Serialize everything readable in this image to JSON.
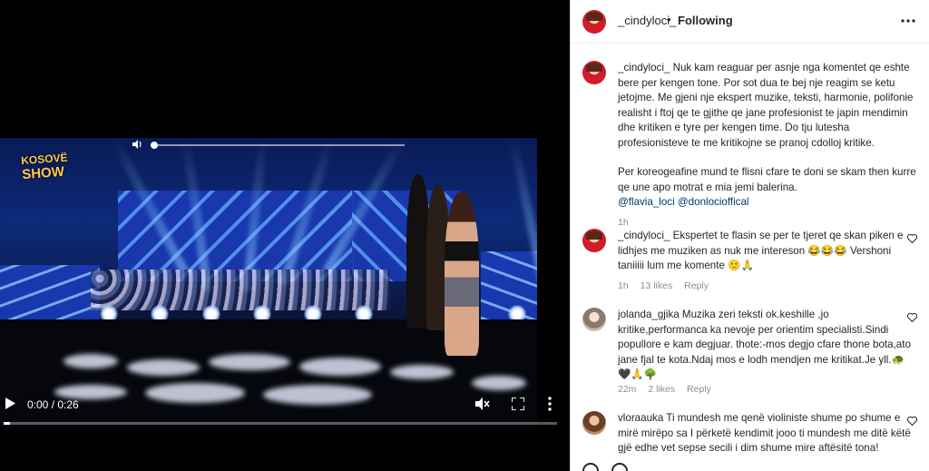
{
  "video": {
    "brand_line1": "KOSOVË",
    "brand_line2": "SHOW",
    "time_display": "0:00 / 0:26",
    "progress": 0.0,
    "volume_icon": "volume-icon",
    "play_icon": "play-icon",
    "mute_icon": "mute-icon",
    "fullscreen_icon": "fullscreen-icon",
    "more_icon": "more-vert-icon"
  },
  "header": {
    "username": "_cindyloci_",
    "separator": "•",
    "follow_status": "Following",
    "more_icon": "more-horiz-icon"
  },
  "caption": {
    "username": "_cindyloci_",
    "text": "Nuk kam reaguar per asnje nga komentet qe eshte bere per kengen tone. Por sot dua te bej nje reagim se ketu jetojme. Me gjeni nje ekspert muzike, teksti, harmonie, polifonie realisht i ftoj qe te gjithe qe jane profesionist te japin mendimin dhe kritiken e tyre per kengen time. Do tju lutesha profesionisteve te me kritikojne se pranoj cdolloj kritike.",
    "text2": "Per koreogeafine mund te flisni cfare te doni se skam then kurre qe une apo motrat e mia jemi balerina.",
    "mentions": "@flavia_loci @donlocioffical",
    "time": "1h"
  },
  "comments": [
    {
      "username": "_cindyloci_",
      "text": "Ekspertet te flasin se per te tjeret qe skan piken e lidhjes me muziken as nuk me intereson 😂😂😂 Vershoni taniiiii lum me komente 🙂🙏",
      "time": "1h",
      "likes": "13 likes",
      "reply": "Reply"
    },
    {
      "username": "jolanda_gjika",
      "text": "Muzika zeri teksti ok.keshille ,jo kritike,performanca ka nevoje per orientim specialisti.Sindi popullore e kam degjuar. thote:-mos degjo cfare thone bota,ato jane fjal te kota.Ndaj mos e lodh mendjen me kritikat.Je yll.🐢🖤🙏🌳",
      "time": "22m",
      "likes": "2 likes",
      "reply": "Reply"
    },
    {
      "username": "vloraauka",
      "text": "Ti mundesh me qenë violiniste shume po shume e mirë mirëpo sa I përketë kendimit jooo ti mundesh me ditë këtë gjë edhe vet sepse secili i dim shume mire aftësitë tona!",
      "time": "",
      "likes": "",
      "reply": ""
    }
  ],
  "heart_icon": "heart-outline-icon",
  "colors": {
    "link": "#00376b",
    "meta_gray": "#8e8e8e",
    "text": "#262626"
  }
}
